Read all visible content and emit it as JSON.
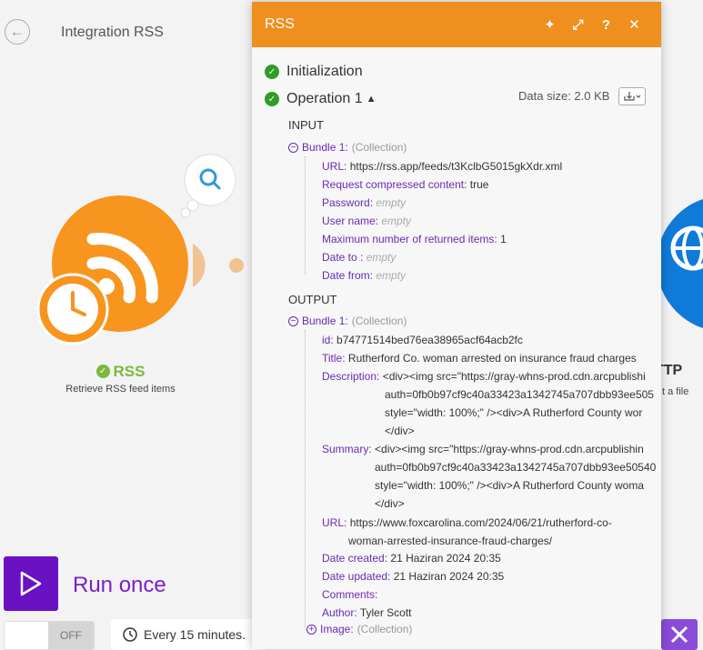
{
  "scenario": {
    "title": "Integration RSS",
    "back_icon": "arrow-left-icon"
  },
  "modules": {
    "rss": {
      "name": "RSS",
      "subtitle": "Retrieve RSS feed items",
      "color": "#f7951f",
      "status_color": "#7cb83b"
    },
    "http": {
      "name": "TTP",
      "subtitle": "t a file",
      "color": "#0f7ad8"
    }
  },
  "controls": {
    "run_once": "Run once",
    "toggle_state": "OFF",
    "schedule": "Every 15 minutes."
  },
  "panel": {
    "title": "RSS",
    "header_color": "#ef8f1e",
    "header_icons": [
      "sparkle-icon",
      "expand-icon",
      "help-icon",
      "close-icon"
    ],
    "initialization": "Initialization",
    "operation": "Operation 1",
    "data_size": "Data size: 2.0 KB",
    "input": {
      "title": "INPUT",
      "bundle": "Bundle 1:",
      "bundle_type": "(Collection)",
      "fields": [
        {
          "key": "URL:",
          "value": "https://rss.app/feeds/t3KclbG5015gkXdr.xml"
        },
        {
          "key": "Request compressed content:",
          "value": "true"
        },
        {
          "key": "Password:",
          "value": "empty"
        },
        {
          "key": "User name:",
          "value": "empty"
        },
        {
          "key": "Maximum number of returned items:",
          "value": "1"
        },
        {
          "key": "Date to :",
          "value": "empty"
        },
        {
          "key": "Date from:",
          "value": "empty"
        }
      ]
    },
    "output": {
      "title": "OUTPUT",
      "bundle": "Bundle 1:",
      "bundle_type": "(Collection)",
      "id": {
        "key": "id:",
        "value": "b74771514bed76ea38965acf64acb2fc"
      },
      "title_field": {
        "key": "Title:",
        "value": "Rutherford Co. woman arrested on insurance fraud charges"
      },
      "description": {
        "key": "Description:",
        "lines": [
          "<div><img src=\"https://gray-whns-prod.cdn.arcpublishi",
          "auth=0fb0b97cf9c40a33423a1342745a707dbb93ee505",
          "style=\"width: 100%;\" /><div>A Rutherford County wor",
          "</div>"
        ]
      },
      "summary": {
        "key": "Summary:",
        "lines": [
          "<div><img src=\"https://gray-whns-prod.cdn.arcpublishin",
          "auth=0fb0b97cf9c40a33423a1342745a707dbb93ee50540",
          "style=\"width: 100%;\" /><div>A Rutherford County woma",
          "</div>"
        ]
      },
      "url": {
        "key": "URL:",
        "lines": [
          "https://www.foxcarolina.com/2024/06/21/rutherford-co-",
          "woman-arrested-insurance-fraud-charges/"
        ]
      },
      "date_created": {
        "key": "Date created:",
        "value": "21 Haziran 2024 20:35"
      },
      "date_updated": {
        "key": "Date updated:",
        "value": "21 Haziran 2024 20:35"
      },
      "comments": {
        "key": "Comments:",
        "value": ""
      },
      "author": {
        "key": "Author:",
        "value": "Tyler Scott"
      },
      "image": {
        "key": "Image:",
        "type": "(Collection)"
      }
    }
  }
}
